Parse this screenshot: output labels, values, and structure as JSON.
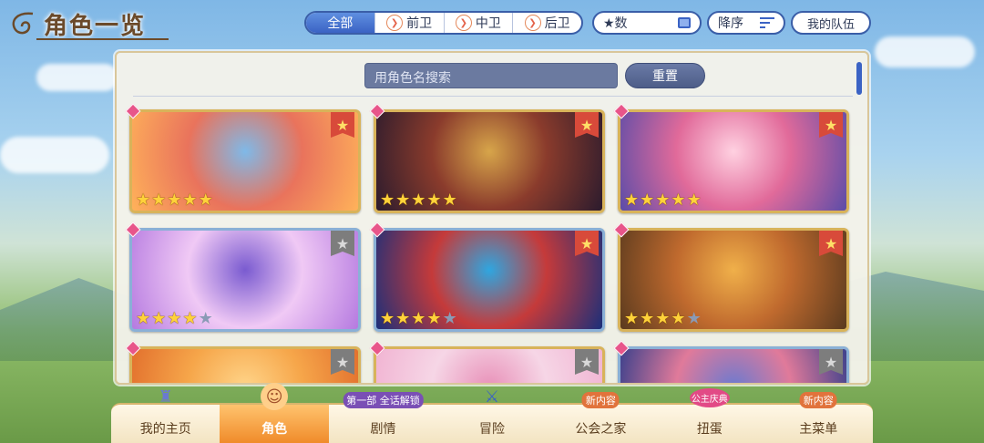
{
  "header": {
    "title": "角色一览",
    "filters": [
      {
        "label": "全部",
        "active": true
      },
      {
        "label": "前卫",
        "active": false
      },
      {
        "label": "中卫",
        "active": false
      },
      {
        "label": "后卫",
        "active": false
      }
    ],
    "star_filter": "★数",
    "sort": "降序",
    "my_team": "我的队伍"
  },
  "panel": {
    "search_placeholder": "用角色名搜索",
    "reset": "重置"
  },
  "colors": {
    "accent": "#3b63c4",
    "gold_border": "#d8b35a",
    "silver_border": "#8ab0d6",
    "favorite_red": "#d84a3a"
  },
  "cards": [
    {
      "stars": 5,
      "favorite": true,
      "border": "gold",
      "bg": [
        "#ffb25a",
        "#e9735c",
        "#7fb9e8"
      ]
    },
    {
      "stars": 5,
      "favorite": true,
      "border": "gold",
      "bg": [
        "#2b1b2d",
        "#8a3b2c",
        "#d7a54a"
      ]
    },
    {
      "stars": 5,
      "favorite": true,
      "border": "gold",
      "bg": [
        "#5b4ca8",
        "#e16a9a",
        "#ffd1e1"
      ]
    },
    {
      "stars": 4,
      "favorite": false,
      "border": "silver",
      "bg": [
        "#b57ae0",
        "#f0c9f5",
        "#7a5bd0"
      ]
    },
    {
      "stars": 4,
      "favorite": true,
      "border": "silver",
      "bg": [
        "#1b2f7a",
        "#c53a3a",
        "#2fa6e0"
      ]
    },
    {
      "stars": 4,
      "favorite": true,
      "border": "gold",
      "bg": [
        "#5a3a1e",
        "#c06a2e",
        "#f0b04a"
      ]
    },
    {
      "stars": 0,
      "favorite": false,
      "border": "gold",
      "bg": [
        "#e06a2a",
        "#f6a64a",
        "#ffd58a"
      ]
    },
    {
      "stars": 0,
      "favorite": false,
      "border": "gold",
      "bg": [
        "#f0b0d0",
        "#f6d6e6",
        "#e890b8"
      ]
    },
    {
      "stars": 0,
      "favorite": false,
      "border": "silver",
      "bg": [
        "#2a3a8a",
        "#e07a9a",
        "#6a7ad0"
      ]
    }
  ],
  "nav": {
    "items": [
      {
        "label": "我的主页",
        "active": false,
        "badge": ""
      },
      {
        "label": "角色",
        "active": true,
        "badge": ""
      },
      {
        "label": "剧情",
        "active": false,
        "badge": "第一部 全话解锁"
      },
      {
        "label": "冒险",
        "active": false,
        "badge": ""
      },
      {
        "label": "公会之家",
        "active": false,
        "badge": "新内容"
      },
      {
        "label": "扭蛋",
        "active": false,
        "badge": "公主庆典"
      },
      {
        "label": "主菜单",
        "active": false,
        "badge": "新内容"
      }
    ]
  }
}
